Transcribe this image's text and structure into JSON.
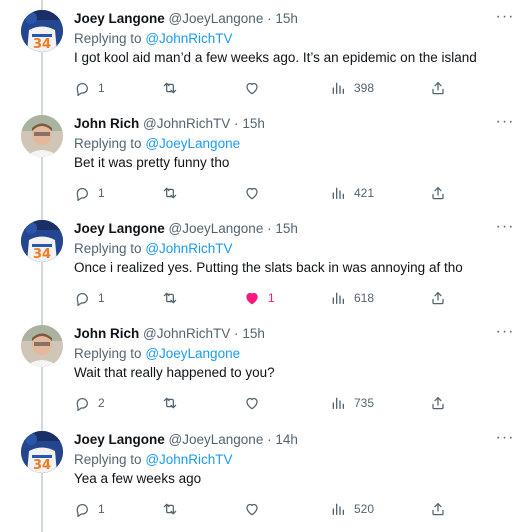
{
  "tweets": [
    {
      "author": "joey",
      "name": "Joey Langone",
      "handle": "@JoeyLangone",
      "dot": "·",
      "time": "15h",
      "replying_prefix": "Replying to",
      "replying_to": "@JohnRichTV",
      "text": "I got kool aid man’d a few weeks ago. It’s an epidemic on the island",
      "replies": "1",
      "retweets": "",
      "likes": "",
      "liked": false,
      "views": "398"
    },
    {
      "author": "john",
      "name": "John Rich",
      "handle": "@JohnRichTV",
      "dot": "·",
      "time": "15h",
      "replying_prefix": "Replying to",
      "replying_to": "@JoeyLangone",
      "text": "Bet it was pretty funny tho",
      "replies": "1",
      "retweets": "",
      "likes": "",
      "liked": false,
      "views": "421"
    },
    {
      "author": "joey",
      "name": "Joey Langone",
      "handle": "@JoeyLangone",
      "dot": "·",
      "time": "15h",
      "replying_prefix": "Replying to",
      "replying_to": "@JohnRichTV",
      "text": "Once i realized yes. Putting the slats back in was annoying af tho",
      "replies": "1",
      "retweets": "",
      "likes": "1",
      "liked": true,
      "views": "618"
    },
    {
      "author": "john",
      "name": "John Rich",
      "handle": "@JohnRichTV",
      "dot": "·",
      "time": "15h",
      "replying_prefix": "Replying to",
      "replying_to": "@JoeyLangone",
      "text": "Wait that really happened to you?",
      "replies": "2",
      "retweets": "",
      "likes": "",
      "liked": false,
      "views": "735"
    },
    {
      "author": "joey",
      "name": "Joey Langone",
      "handle": "@JoeyLangone",
      "dot": "·",
      "time": "14h",
      "replying_prefix": "Replying to",
      "replying_to": "@JohnRichTV",
      "text": "Yea a few weeks ago",
      "replies": "1",
      "retweets": "",
      "likes": "",
      "liked": false,
      "views": "520"
    }
  ],
  "more_label": "···",
  "colors": {
    "link": "#1d9bf0",
    "muted": "#536471",
    "like_active": "#f91880",
    "thread_line": "#cfd9de"
  },
  "icons": [
    "reply-icon",
    "retweet-icon",
    "like-icon",
    "views-icon",
    "share-icon",
    "more-icon"
  ]
}
